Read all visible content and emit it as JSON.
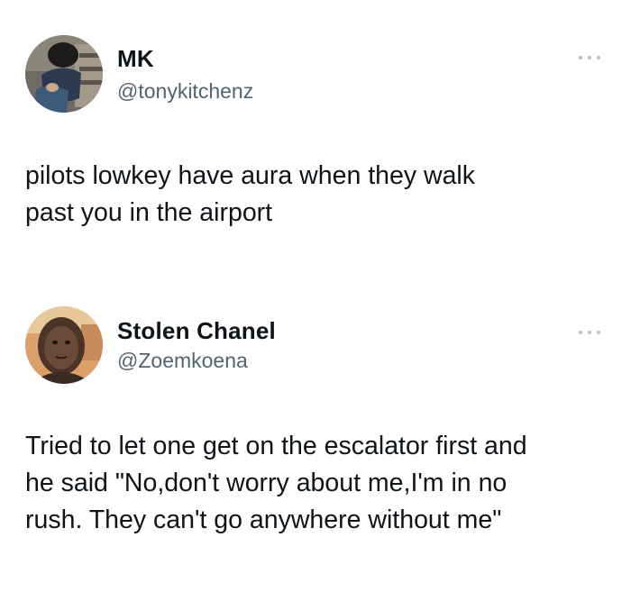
{
  "tweets": [
    {
      "display_name": "MK",
      "handle": "@tonykitchenz",
      "avatar_icon": "profile-photo-person-sitting",
      "more_icon": "more-options-icon",
      "text": "pilots lowkey have aura when they walk\npast you in the airport"
    },
    {
      "display_name": "Stolen Chanel",
      "handle": "@Zoemkoena",
      "avatar_icon": "profile-photo-face",
      "more_icon": "more-options-icon",
      "text": "Tried to let one get on the escalator first and\nhe said \"No,don't worry about me,I'm in no\nrush. They can't go anywhere without me\""
    }
  ],
  "colors": {
    "background": "#ffffff",
    "text": "#0f1419",
    "secondary": "#536471",
    "more_dots": "#b8c0c7"
  }
}
